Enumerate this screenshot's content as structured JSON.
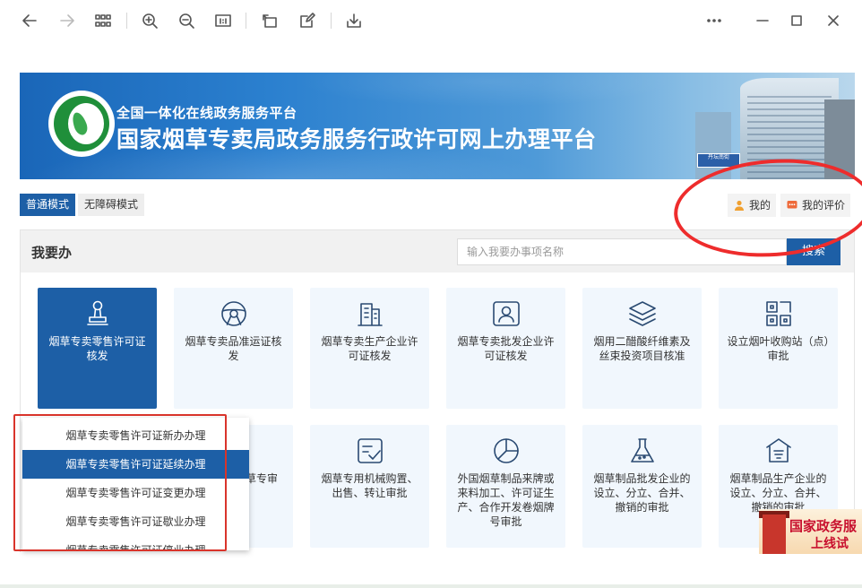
{
  "banner": {
    "subtitle": "全国一体化在线政务服务平台",
    "title": "国家烟草专卖局政务服务行政许可网上办理平台",
    "sign_text": "丹坛南街"
  },
  "modes": {
    "normal": "普通模式",
    "accessible": "无障碍模式"
  },
  "user": {
    "mine": "我的",
    "my_evaluation": "我的评价"
  },
  "main": {
    "title": "我要办",
    "search_placeholder": "输入我要办事项名称",
    "search_button": "搜索"
  },
  "cards": [
    {
      "label": "烟草专卖零售许可证核发",
      "icon": "stamp-icon"
    },
    {
      "label": "烟草专卖品准运证核发",
      "icon": "steering-wheel-icon"
    },
    {
      "label": "烟草专卖生产企业许可证核发",
      "icon": "building-icon"
    },
    {
      "label": "烟草专卖批发企业许可证核发",
      "icon": "id-card-icon"
    },
    {
      "label": "烟用二醋酸纤维素及丝束投资项目核准",
      "icon": "layers-icon"
    },
    {
      "label": "设立烟叶收购站（点）审批",
      "icon": "grid-icon"
    },
    {
      "label": "烟草专审批",
      "icon": "document-icon"
    },
    {
      "label": "烟草专用机械购置、出售、转让审批",
      "icon": "checklist-icon"
    },
    {
      "label": "外国烟草制品来牌或来料加工、许可证生产、合作开发卷烟牌号审批",
      "icon": "pie-chart-icon"
    },
    {
      "label": "烟草制品批发企业的设立、分立、合并、撤销的审批",
      "icon": "flask-icon"
    },
    {
      "label": "烟草制品生产企业的设立、分立、合并、撤销的审批",
      "icon": "shop-icon"
    }
  ],
  "dropdown": {
    "items": [
      "烟草专卖零售许可证新办办理",
      "烟草专卖零售许可证延续办理",
      "烟草专卖零售许可证变更办理",
      "烟草专卖零售许可证歇业办理",
      "烟草专卖零售许可证停业办理"
    ],
    "highlighted_index": 1
  },
  "promo": {
    "line1": "国家政务服",
    "line2": "上线试"
  },
  "colors": {
    "primary": "#1d5fa6",
    "card_bg": "#f1f7fd",
    "annotation_red": "#ee2c2c"
  }
}
